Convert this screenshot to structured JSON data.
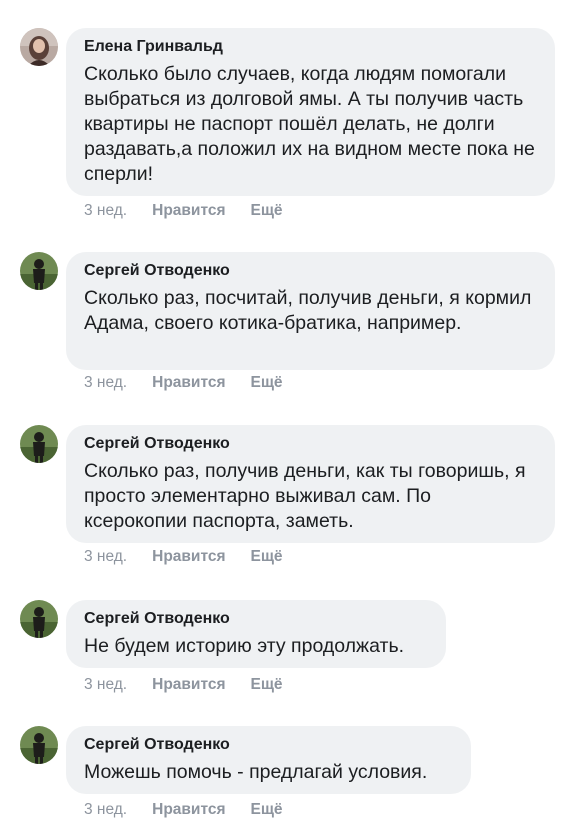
{
  "comments": [
    {
      "author": "Елена Гринвальд",
      "text": "Сколько было случаев, когда людям помогали выбраться из долговой ямы. А ты получив часть квартиры не паспорт пошёл делать, не долги раздавать,а положил их на видном месте пока не сперли!",
      "time": "3 нед.",
      "like": "Нравится",
      "more": "Ещё",
      "avatar_icon": "user-photo-female"
    },
    {
      "author": "Сергей Отводенко",
      "text": "Сколько раз, посчитай, получив деньги, я кормил Адама, своего котика-братика, например.",
      "time": "3 нед.",
      "like": "Нравится",
      "more": "Ещё",
      "avatar_icon": "user-photo-silhouette"
    },
    {
      "author": "Сергей Отводенко",
      "text": "Сколько раз, получив деньги, как ты говоришь, я просто элементарно выживал сам. По ксерокопии паспорта, заметь.",
      "time": "3 нед.",
      "like": "Нравится",
      "more": "Ещё",
      "avatar_icon": "user-photo-silhouette"
    },
    {
      "author": "Сергей Отводенко",
      "text": "Не будем историю эту продолжать.",
      "time": "3 нед.",
      "like": "Нравится",
      "more": "Ещё",
      "avatar_icon": "user-photo-silhouette"
    },
    {
      "author": "Сергей Отводенко",
      "text": "Можешь помочь - предлагай условия.",
      "time": "3 нед.",
      "like": "Нравится",
      "more": "Ещё",
      "avatar_icon": "user-photo-silhouette"
    }
  ],
  "colors": {
    "bubble": "#eff1f3",
    "text": "#1c1e21",
    "meta": "#8d949e"
  }
}
